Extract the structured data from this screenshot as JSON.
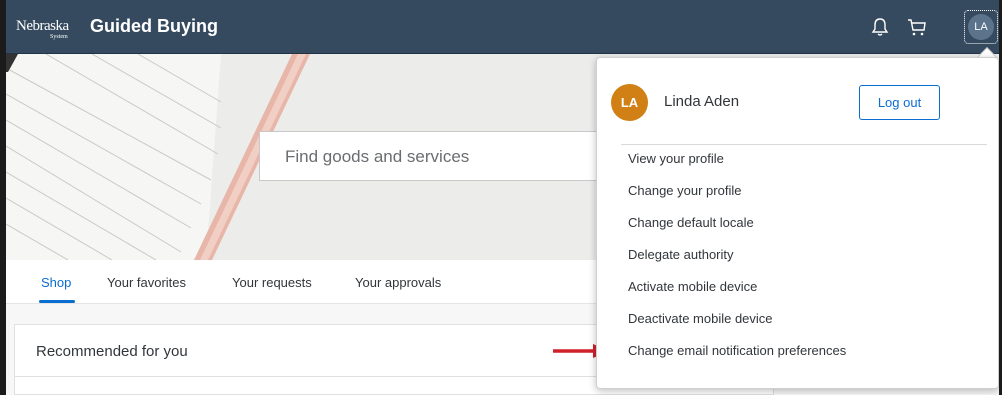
{
  "header": {
    "logo_text": "Nebraska",
    "logo_sub": "System",
    "title": "Guided Buying",
    "icons": [
      "bell-icon",
      "cart-icon"
    ],
    "avatar_initials": "LA"
  },
  "search": {
    "placeholder": "Find goods and services"
  },
  "tabs": [
    {
      "label": "Shop",
      "active": true
    },
    {
      "label": "Your favorites"
    },
    {
      "label": "Your requests"
    },
    {
      "label": "Your approvals"
    }
  ],
  "recommended": {
    "title": "Recommended for you"
  },
  "user_menu": {
    "initials": "LA",
    "name": "Linda Aden",
    "logout_label": "Log out",
    "items": [
      "View your profile",
      "Change your profile",
      "Change default locale",
      "Delegate authority",
      "Activate mobile device",
      "Deactivate mobile device",
      "Change email notification preferences"
    ]
  },
  "colors": {
    "header_bg": "#354a5f",
    "accent": "#0a6ed1",
    "user_avatar": "#d08014",
    "annotation_arrow": "#d0202a"
  }
}
